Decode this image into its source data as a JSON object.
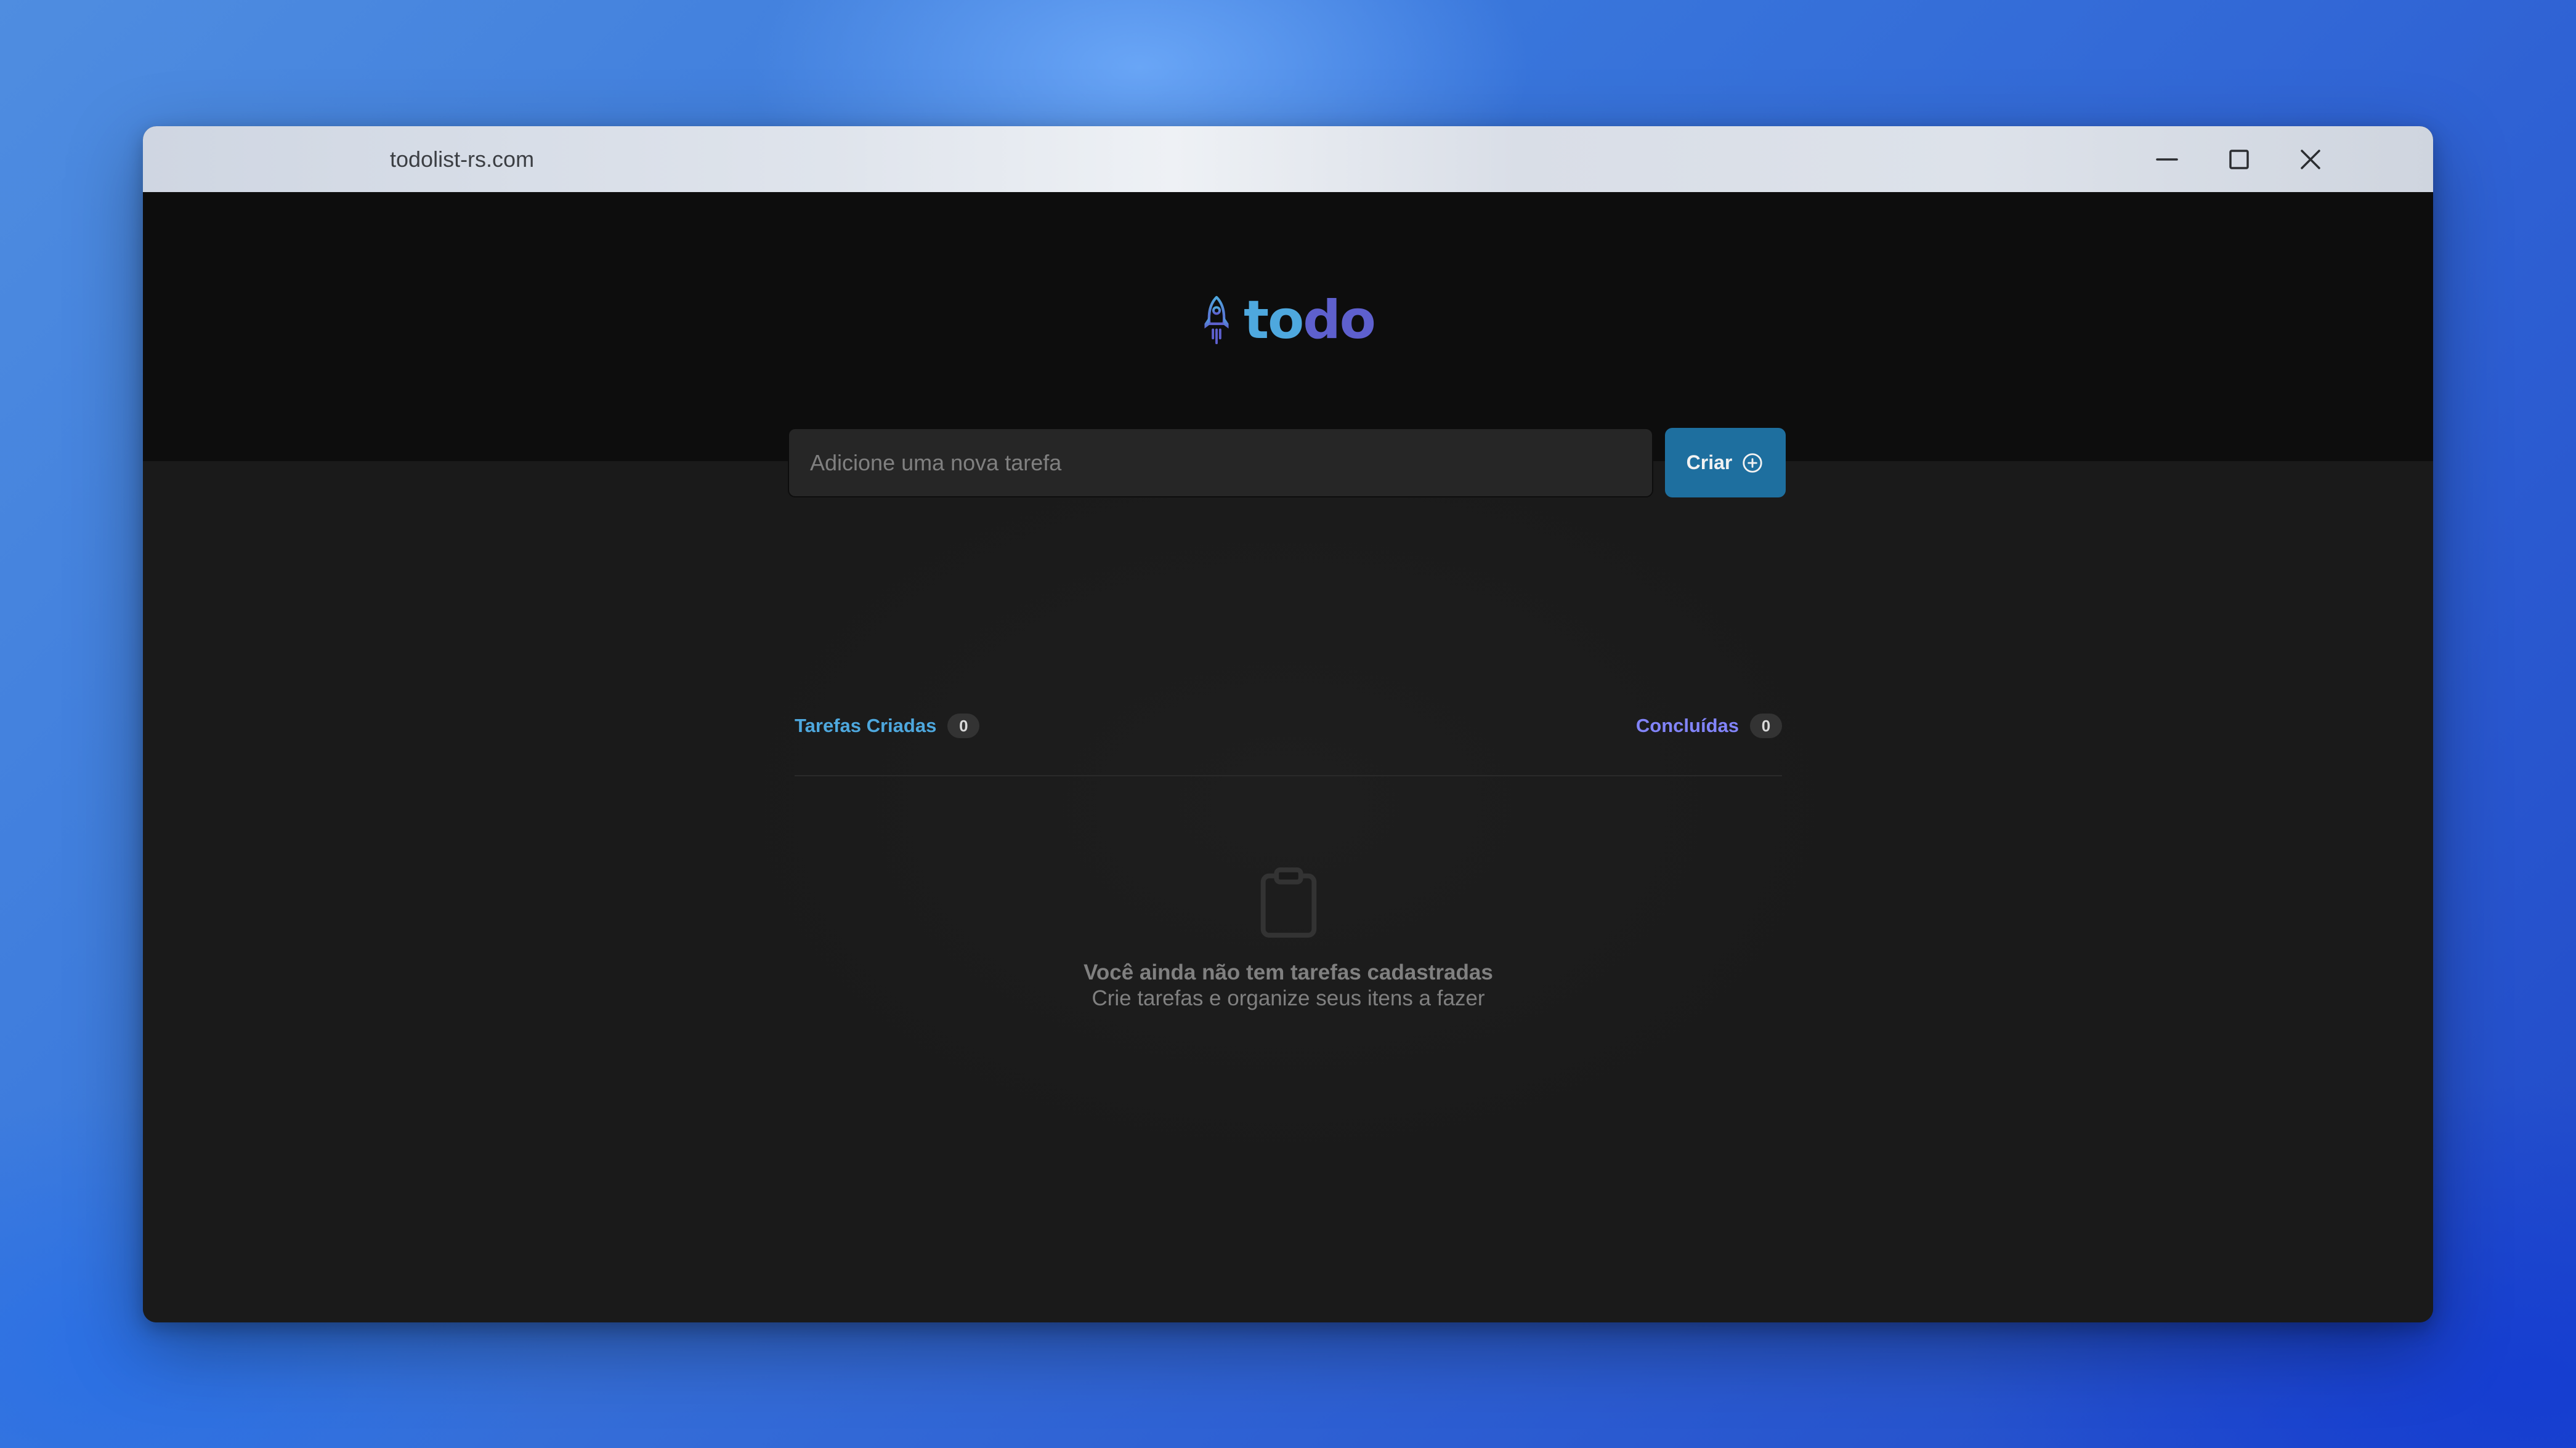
{
  "window": {
    "url": "todolist-rs.com",
    "controls": [
      {
        "name": "minimize-icon"
      },
      {
        "name": "maximize-icon"
      },
      {
        "name": "close-icon"
      }
    ]
  },
  "logo": {
    "icon": "rocket-icon",
    "text_to": "to",
    "text_do": "do"
  },
  "new_task": {
    "placeholder": "Adicione uma nova tarefa",
    "value": "",
    "create_label": "Criar",
    "create_icon": "plus-circle-icon"
  },
  "counters": {
    "created_label": "Tarefas Criadas",
    "created_count": "0",
    "done_label": "Concluídas",
    "done_count": "0"
  },
  "empty_state": {
    "icon": "clipboard-icon",
    "title": "Você ainda não tem tarefas cadastradas",
    "subtitle": "Crie tarefas e organize seus itens a fazer"
  },
  "colors": {
    "blue": "#4ea8de",
    "purple": "#5e60ce",
    "purple_light": "#8284fa",
    "button": "#1e6f9f",
    "header_bg": "#0d0d0d",
    "body_bg": "#1a1a1a",
    "input_bg": "#262626",
    "muted_text": "#808080"
  }
}
